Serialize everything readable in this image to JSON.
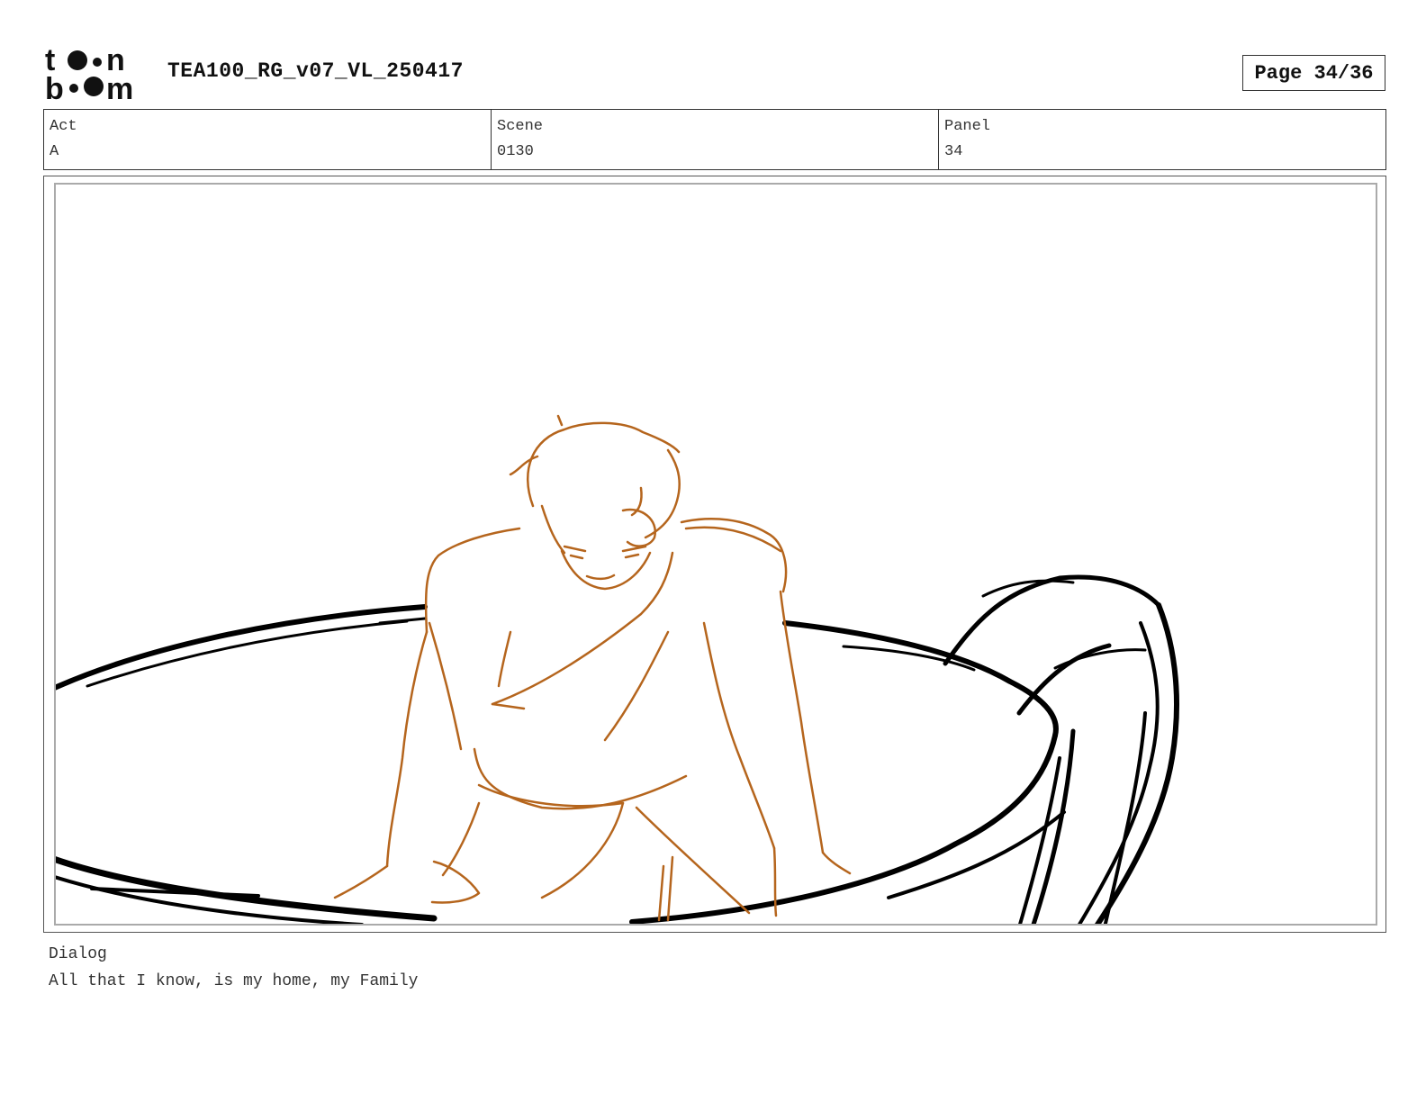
{
  "header": {
    "logo_text_top": "toon",
    "logo_text_bottom": "boom",
    "document_title": "TEA100_RG_v07_VL_250417",
    "page_indicator": "Page 34/36"
  },
  "meta": {
    "act_label": "Act",
    "act_value": "A",
    "scene_label": "Scene",
    "scene_value": "0130",
    "panel_label": "Panel",
    "panel_value": "34"
  },
  "dialog": {
    "label": "Dialog",
    "text": "All that I know, is my home, my Family"
  },
  "colors": {
    "character_line": "#b5651d",
    "prop_line": "#000000",
    "border": "#333333"
  }
}
